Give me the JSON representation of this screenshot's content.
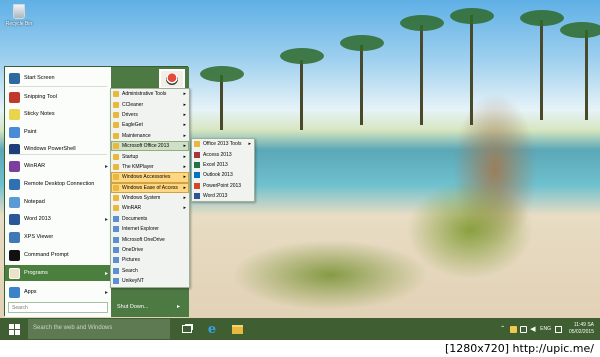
{
  "desktop": {
    "recycle_bin_label": "Recycle Bin"
  },
  "start_menu": {
    "items": [
      {
        "label": "Start Screen",
        "icon": "start-screen-icon",
        "color": "#2d6a9f",
        "arrow": false
      },
      {
        "label": "Snipping Tool",
        "icon": "scissors-icon",
        "color": "#c0392b",
        "arrow": false
      },
      {
        "label": "Sticky Notes",
        "icon": "sticky-note-icon",
        "color": "#e9d44c",
        "arrow": false
      },
      {
        "label": "Paint",
        "icon": "palette-icon",
        "color": "#4a8bd6",
        "arrow": false
      },
      {
        "label": "Windows PowerShell",
        "icon": "powershell-icon",
        "color": "#1f3f7a",
        "arrow": false
      },
      {
        "label": "WinRAR",
        "icon": "archive-icon",
        "color": "#7b3fa0",
        "arrow": true
      },
      {
        "label": "Remote Desktop Connection",
        "icon": "remote-desktop-icon",
        "color": "#2f6fb4",
        "arrow": false
      },
      {
        "label": "Notepad",
        "icon": "notepad-icon",
        "color": "#5b9bd5",
        "arrow": false
      },
      {
        "label": "Word 2013",
        "icon": "word-icon",
        "color": "#2b579a",
        "arrow": true
      },
      {
        "label": "XPS Viewer",
        "icon": "xps-viewer-icon",
        "color": "#3f7ab6",
        "arrow": false
      },
      {
        "label": "Command Prompt",
        "icon": "terminal-icon",
        "color": "#111111",
        "arrow": false
      }
    ],
    "programs_label": "Programs",
    "apps_label": "Apps",
    "search_placeholder": "Search",
    "shutdown_label": "Shut Down...",
    "shutdown_arrow": "▸"
  },
  "programs_menu": {
    "items": [
      {
        "label": "Administrative Tools",
        "icon": "folder-icon",
        "arrow": true
      },
      {
        "label": "CCleaner",
        "icon": "folder-icon",
        "arrow": true
      },
      {
        "label": "Drivers",
        "icon": "folder-icon",
        "arrow": true
      },
      {
        "label": "EagleGet",
        "icon": "folder-icon",
        "arrow": true
      },
      {
        "label": "Maintenance",
        "icon": "folder-icon",
        "arrow": true
      },
      {
        "label": "Microsoft Office 2013",
        "icon": "folder-icon",
        "arrow": true
      },
      {
        "label": "Startup",
        "icon": "folder-icon",
        "arrow": true
      },
      {
        "label": "The KMPlayer",
        "icon": "folder-icon",
        "arrow": true
      },
      {
        "label": "Windows Accessories",
        "icon": "folder-icon",
        "arrow": true
      },
      {
        "label": "Windows Ease of Access",
        "icon": "folder-icon",
        "arrow": true
      },
      {
        "label": "Windows System",
        "icon": "folder-icon",
        "arrow": true
      },
      {
        "label": "WinRAR",
        "icon": "folder-icon",
        "arrow": true
      },
      {
        "label": "Documents",
        "icon": "documents-icon",
        "arrow": false
      },
      {
        "label": "Internet Explorer",
        "icon": "internet-explorer-icon",
        "arrow": false
      },
      {
        "label": "Microsoft OneDrive",
        "icon": "onedrive-icon",
        "arrow": false
      },
      {
        "label": "OneDrive",
        "icon": "onedrive-icon",
        "arrow": false
      },
      {
        "label": "Pictures",
        "icon": "pictures-icon",
        "arrow": false
      },
      {
        "label": "Search",
        "icon": "search-icon",
        "arrow": false
      },
      {
        "label": "UnikeyNT",
        "icon": "unikey-icon",
        "arrow": false
      }
    ]
  },
  "office_menu": {
    "items": [
      {
        "label": "Office 2013 Tools",
        "icon": "folder-icon",
        "color": "#e8b93a",
        "arrow": true
      },
      {
        "label": "Access 2013",
        "icon": "access-icon",
        "color": "#a4373a",
        "arrow": false
      },
      {
        "label": "Excel 2013",
        "icon": "excel-icon",
        "color": "#217346",
        "arrow": false
      },
      {
        "label": "Outlook 2013",
        "icon": "outlook-icon",
        "color": "#0072c6",
        "arrow": false
      },
      {
        "label": "PowerPoint 2013",
        "icon": "powerpoint-icon",
        "color": "#d24726",
        "arrow": false
      },
      {
        "label": "Word 2013",
        "icon": "word-icon",
        "color": "#2b579a",
        "arrow": false
      }
    ]
  },
  "taskbar": {
    "search_placeholder": "Search the web and Windows",
    "language": "ENG",
    "time": "11:49 SA",
    "date": "05/02/2015"
  },
  "watermark": "[1280x720] http://upic.me/"
}
